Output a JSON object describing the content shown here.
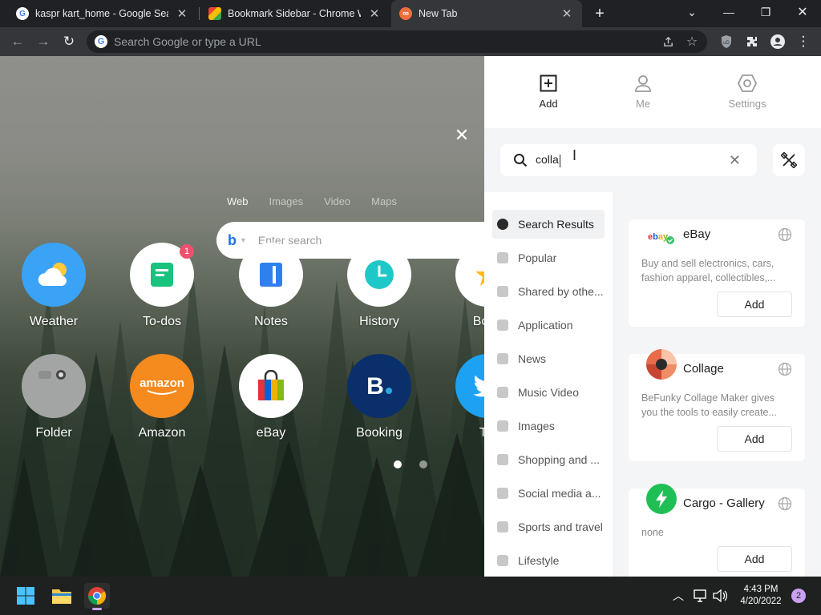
{
  "browser": {
    "tabs": [
      {
        "title": "kaspr kart_home - Google Search",
        "icon": "google-icon"
      },
      {
        "title": "Bookmark Sidebar - Chrome Web Store",
        "icon": "webstore-icon"
      },
      {
        "title": "New Tab",
        "icon": "infinity-icon"
      }
    ],
    "omnibox_placeholder": "Search Google or type a URL"
  },
  "newtab": {
    "search_tabs": [
      "Web",
      "Images",
      "Video",
      "Maps"
    ],
    "search_placeholder": "Enter search",
    "apps_row1": [
      {
        "label": "Weather",
        "icon": "weather-icon",
        "color": "#3aa3f5"
      },
      {
        "label": "To-dos",
        "icon": "todos-icon",
        "color": "#ffffff",
        "badge": "1"
      },
      {
        "label": "Notes",
        "icon": "notes-icon",
        "color": "#ffffff"
      },
      {
        "label": "History",
        "icon": "history-icon",
        "color": "#ffffff"
      },
      {
        "label": "Book",
        "icon": "bookmark-icon",
        "color": "#ffffff"
      }
    ],
    "apps_row2": [
      {
        "label": "Folder",
        "icon": "folder-icon",
        "color": "#a3a5a4"
      },
      {
        "label": "Amazon",
        "icon": "amazon-icon",
        "color": "#f58a1f"
      },
      {
        "label": "eBay",
        "icon": "ebay-bag-icon",
        "color": "#ffffff"
      },
      {
        "label": "Booking",
        "icon": "booking-icon",
        "color": "#0b2f6a"
      },
      {
        "label": "Tw",
        "icon": "twitter-icon",
        "color": "#1da1f2"
      }
    ]
  },
  "panel": {
    "nav": [
      {
        "label": "Add",
        "icon": "add-square-icon"
      },
      {
        "label": "Me",
        "icon": "user-icon"
      },
      {
        "label": "Settings",
        "icon": "settings-hex-icon"
      }
    ],
    "search_value": "colla",
    "categories": [
      "Search Results",
      "Popular",
      "Shared by othe...",
      "Application",
      "News",
      "Music Video",
      "Images",
      "Shopping and ...",
      "Social media a...",
      "Sports and travel",
      "Lifestyle"
    ],
    "results": [
      {
        "name": "eBay",
        "description": "Buy and sell electronics, cars, fashion apparel, collectibles,...",
        "button": "Add"
      },
      {
        "name": "Collage",
        "description": "BeFunky Collage Maker gives you the tools to easily create...",
        "button": "Add"
      },
      {
        "name": "Cargo - Gallery",
        "description": "none",
        "button": "Add"
      }
    ]
  },
  "taskbar": {
    "time": "4:43 PM",
    "date": "4/20/2022",
    "notifications": "2"
  }
}
